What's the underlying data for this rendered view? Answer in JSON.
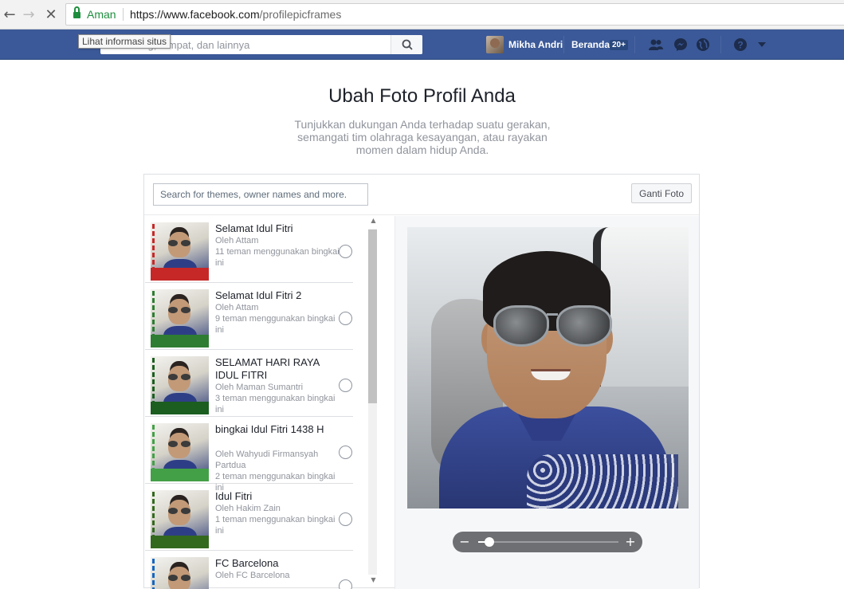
{
  "browser": {
    "security_label": "Aman",
    "url_host": "https://www.facebook.com",
    "url_path": "/profilepicframes"
  },
  "fb": {
    "search_placeholder": "Cari orang, tempat, dan lainnya",
    "tooltip": "Lihat informasi situs",
    "user_name": "Mikha Andri",
    "home_label": "Beranda",
    "home_count": "20+",
    "brand_color": "#3b5998"
  },
  "page": {
    "title": "Ubah Foto Profil Anda",
    "subtitle": "Tunjukkan dukungan Anda terhadap suatu gerakan, semangati tim olahraga kesayangan, atau rayakan momen dalam hidup Anda."
  },
  "frames": {
    "search_placeholder": "Search for themes, owner names and more.",
    "change_button": "Ganti Foto",
    "items": [
      {
        "title": "Selamat Idul Fitri",
        "owner": "Oleh Attam",
        "usage": "11 teman menggunakan bingkai ini",
        "deco": "#c62828"
      },
      {
        "title": "Selamat Idul Fitri 2",
        "owner": "Oleh Attam",
        "usage": "9 teman menggunakan bingkai ini",
        "deco": "#2e7d32"
      },
      {
        "title": "SELAMAT HARI RAYA IDUL FITRI",
        "owner": "Oleh Maman Sumantri",
        "usage": "3 teman menggunakan bingkai ini",
        "deco": "#1b5e20"
      },
      {
        "title": "bingkai Idul Fitri 1438 H",
        "owner": "Oleh Wahyudi Firmansyah Partdua",
        "usage": "2 teman menggunakan bingkai ini",
        "deco": "#43a047"
      },
      {
        "title": "Idul Fitri",
        "owner": "Oleh Hakim Zain",
        "usage": "1 teman menggunakan bingkai ini",
        "deco": "#33691e"
      },
      {
        "title": "FC Barcelona",
        "owner": "Oleh FC Barcelona",
        "usage": "",
        "deco": "#1565c0"
      }
    ]
  },
  "zoom": {
    "minus": "−",
    "plus": "+",
    "level": 0.08
  }
}
